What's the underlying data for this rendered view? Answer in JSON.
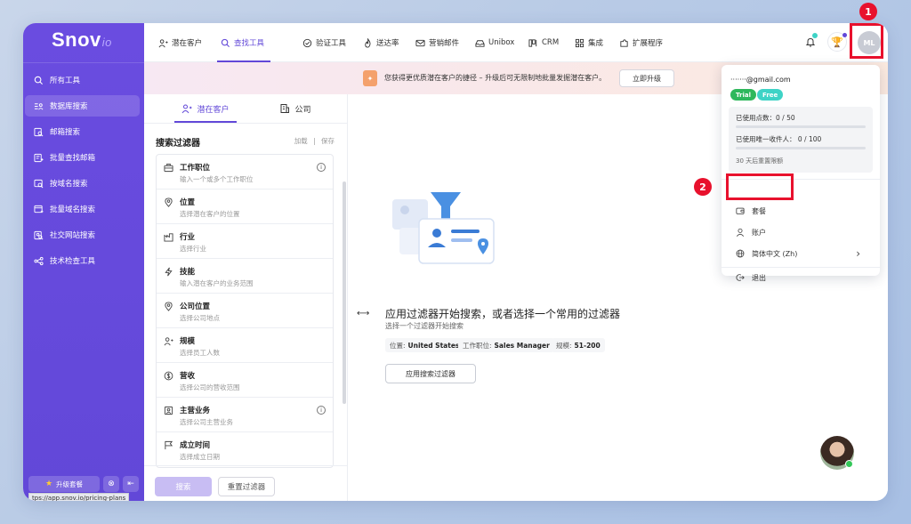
{
  "sidebar": {
    "logo": "Snov",
    "logo_suffix": "io",
    "items": [
      {
        "label": "所有工具",
        "icon": "globe-search-icon"
      },
      {
        "label": "数据库搜索",
        "icon": "list-user-icon"
      },
      {
        "label": "邮箱搜索",
        "icon": "mail-search-icon"
      },
      {
        "label": "批量查找邮箱",
        "icon": "bulk-mail-icon"
      },
      {
        "label": "按域名搜索",
        "icon": "domain-search-icon"
      },
      {
        "label": "批量域名搜索",
        "icon": "bulk-domain-icon"
      },
      {
        "label": "社交网站搜索",
        "icon": "social-search-icon"
      },
      {
        "label": "技术检查工具",
        "icon": "tech-check-icon"
      }
    ],
    "upgrade_label": "升级套餐",
    "status_url": "tps://app.snov.io/pricing-plans"
  },
  "topnav": {
    "items": [
      {
        "label": "潜在客户"
      },
      {
        "label": "查找工具"
      },
      {
        "label": "验证工具"
      },
      {
        "label": "送达率"
      },
      {
        "label": "营销邮件"
      },
      {
        "label": "Unibox"
      },
      {
        "label": "CRM"
      },
      {
        "label": "集成"
      },
      {
        "label": "扩展程序"
      }
    ],
    "avatar_initials": "ML"
  },
  "banner": {
    "text": "您获得更优质潜在客户的捷径 – 升级后可无限制地批量发掘潜在客户。",
    "button": "立即升级"
  },
  "filters": {
    "tabs": [
      "潜在客户",
      "公司"
    ],
    "title": "搜索过滤器",
    "load": "加载",
    "sep": "|",
    "save": "保存",
    "items": [
      {
        "title": "工作职位",
        "sub": "输入一个或多个工作职位",
        "info": "i"
      },
      {
        "title": "位置",
        "sub": "选择潜在客户的位置"
      },
      {
        "title": "行业",
        "sub": "选择行业"
      },
      {
        "title": "技能",
        "sub": "输入潜在客户的业务范围"
      },
      {
        "title": "公司位置",
        "sub": "选择公司地点"
      },
      {
        "title": "规模",
        "sub": "选择员工人数"
      },
      {
        "title": "营收",
        "sub": "选择公司的营收范围"
      },
      {
        "title": "主营业务",
        "sub": "选择公司主营业务",
        "info": "i"
      },
      {
        "title": "成立时间",
        "sub": "选择成立日期"
      }
    ],
    "search_button": "搜索",
    "reset_button": "重置过滤器"
  },
  "main": {
    "arrow": "⟷",
    "title": "应用过滤器开始搜索，或者选择一个常用的过滤器",
    "subtitle": "选择一个过滤器开始搜索",
    "chips": [
      {
        "label": "位置:",
        "value": "United States"
      },
      {
        "label": "工作职位:",
        "value": "Sales Manager"
      },
      {
        "label": "规模:",
        "value": "51-200"
      }
    ],
    "apply_button": "应用搜索过滤器"
  },
  "dropdown": {
    "email": "·······@gmail.com",
    "pills": [
      "Trial",
      "Free"
    ],
    "credits_label": "已使用点数：0 / 50",
    "recipients_label": "已使用唯一收件人：  0 / 100",
    "reset_note": "30 天后重置限额",
    "items": [
      {
        "label": "套餐",
        "icon": "wallet-icon"
      },
      {
        "label": "账户",
        "icon": "user-icon"
      },
      {
        "label": "简体中文 (Zh)",
        "icon": "globe-icon"
      },
      {
        "label": "退出",
        "icon": "logout-icon"
      }
    ],
    "chevron": "›"
  },
  "annotations": [
    "1",
    "2"
  ],
  "colors": {
    "brand": "#6248d8",
    "highlight": "#e8112d",
    "trial": "#2eb85c",
    "free": "#3ed3c6"
  }
}
